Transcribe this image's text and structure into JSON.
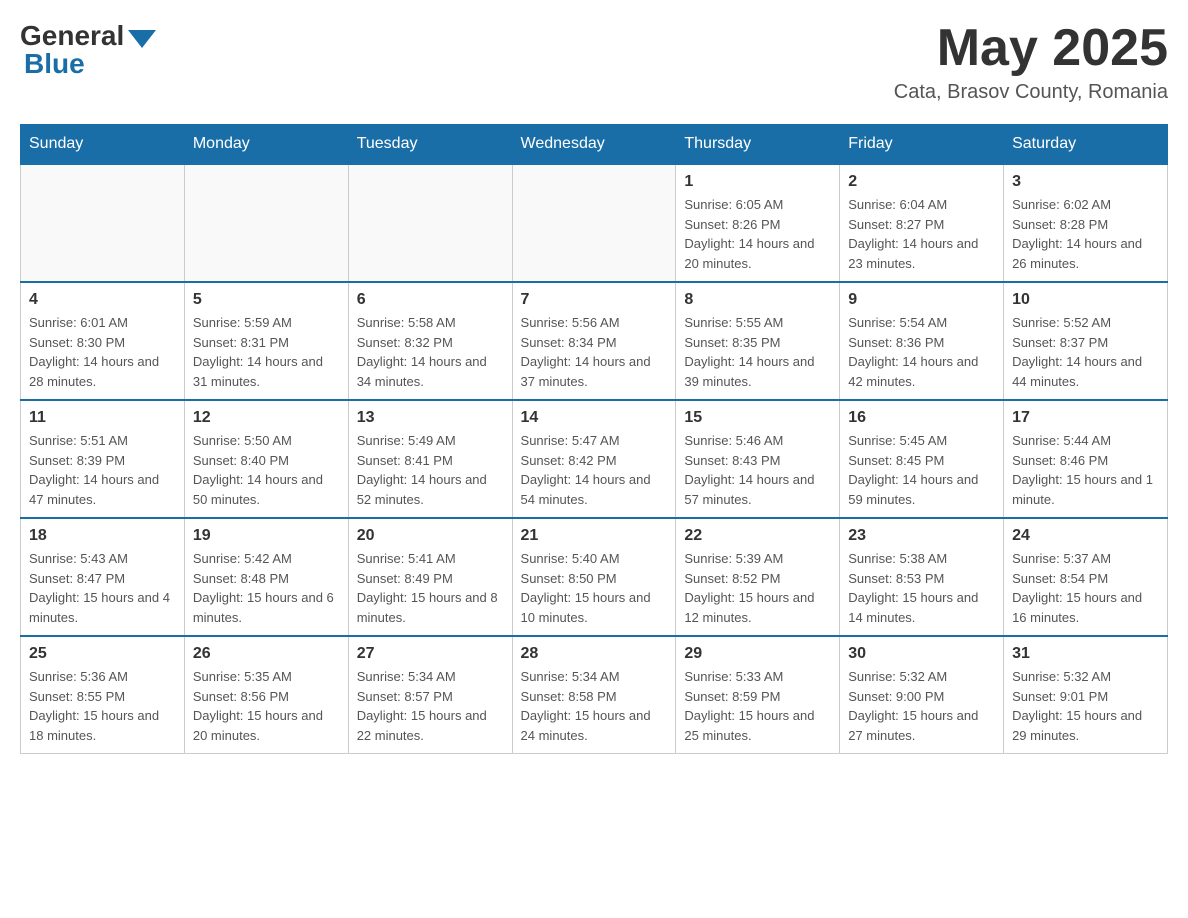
{
  "header": {
    "logo": {
      "general": "General",
      "blue": "Blue"
    },
    "title": "May 2025",
    "location": "Cata, Brasov County, Romania"
  },
  "days_of_week": [
    "Sunday",
    "Monday",
    "Tuesday",
    "Wednesday",
    "Thursday",
    "Friday",
    "Saturday"
  ],
  "weeks": [
    [
      {
        "day": "",
        "info": ""
      },
      {
        "day": "",
        "info": ""
      },
      {
        "day": "",
        "info": ""
      },
      {
        "day": "",
        "info": ""
      },
      {
        "day": "1",
        "info": "Sunrise: 6:05 AM\nSunset: 8:26 PM\nDaylight: 14 hours and 20 minutes."
      },
      {
        "day": "2",
        "info": "Sunrise: 6:04 AM\nSunset: 8:27 PM\nDaylight: 14 hours and 23 minutes."
      },
      {
        "day": "3",
        "info": "Sunrise: 6:02 AM\nSunset: 8:28 PM\nDaylight: 14 hours and 26 minutes."
      }
    ],
    [
      {
        "day": "4",
        "info": "Sunrise: 6:01 AM\nSunset: 8:30 PM\nDaylight: 14 hours and 28 minutes."
      },
      {
        "day": "5",
        "info": "Sunrise: 5:59 AM\nSunset: 8:31 PM\nDaylight: 14 hours and 31 minutes."
      },
      {
        "day": "6",
        "info": "Sunrise: 5:58 AM\nSunset: 8:32 PM\nDaylight: 14 hours and 34 minutes."
      },
      {
        "day": "7",
        "info": "Sunrise: 5:56 AM\nSunset: 8:34 PM\nDaylight: 14 hours and 37 minutes."
      },
      {
        "day": "8",
        "info": "Sunrise: 5:55 AM\nSunset: 8:35 PM\nDaylight: 14 hours and 39 minutes."
      },
      {
        "day": "9",
        "info": "Sunrise: 5:54 AM\nSunset: 8:36 PM\nDaylight: 14 hours and 42 minutes."
      },
      {
        "day": "10",
        "info": "Sunrise: 5:52 AM\nSunset: 8:37 PM\nDaylight: 14 hours and 44 minutes."
      }
    ],
    [
      {
        "day": "11",
        "info": "Sunrise: 5:51 AM\nSunset: 8:39 PM\nDaylight: 14 hours and 47 minutes."
      },
      {
        "day": "12",
        "info": "Sunrise: 5:50 AM\nSunset: 8:40 PM\nDaylight: 14 hours and 50 minutes."
      },
      {
        "day": "13",
        "info": "Sunrise: 5:49 AM\nSunset: 8:41 PM\nDaylight: 14 hours and 52 minutes."
      },
      {
        "day": "14",
        "info": "Sunrise: 5:47 AM\nSunset: 8:42 PM\nDaylight: 14 hours and 54 minutes."
      },
      {
        "day": "15",
        "info": "Sunrise: 5:46 AM\nSunset: 8:43 PM\nDaylight: 14 hours and 57 minutes."
      },
      {
        "day": "16",
        "info": "Sunrise: 5:45 AM\nSunset: 8:45 PM\nDaylight: 14 hours and 59 minutes."
      },
      {
        "day": "17",
        "info": "Sunrise: 5:44 AM\nSunset: 8:46 PM\nDaylight: 15 hours and 1 minute."
      }
    ],
    [
      {
        "day": "18",
        "info": "Sunrise: 5:43 AM\nSunset: 8:47 PM\nDaylight: 15 hours and 4 minutes."
      },
      {
        "day": "19",
        "info": "Sunrise: 5:42 AM\nSunset: 8:48 PM\nDaylight: 15 hours and 6 minutes."
      },
      {
        "day": "20",
        "info": "Sunrise: 5:41 AM\nSunset: 8:49 PM\nDaylight: 15 hours and 8 minutes."
      },
      {
        "day": "21",
        "info": "Sunrise: 5:40 AM\nSunset: 8:50 PM\nDaylight: 15 hours and 10 minutes."
      },
      {
        "day": "22",
        "info": "Sunrise: 5:39 AM\nSunset: 8:52 PM\nDaylight: 15 hours and 12 minutes."
      },
      {
        "day": "23",
        "info": "Sunrise: 5:38 AM\nSunset: 8:53 PM\nDaylight: 15 hours and 14 minutes."
      },
      {
        "day": "24",
        "info": "Sunrise: 5:37 AM\nSunset: 8:54 PM\nDaylight: 15 hours and 16 minutes."
      }
    ],
    [
      {
        "day": "25",
        "info": "Sunrise: 5:36 AM\nSunset: 8:55 PM\nDaylight: 15 hours and 18 minutes."
      },
      {
        "day": "26",
        "info": "Sunrise: 5:35 AM\nSunset: 8:56 PM\nDaylight: 15 hours and 20 minutes."
      },
      {
        "day": "27",
        "info": "Sunrise: 5:34 AM\nSunset: 8:57 PM\nDaylight: 15 hours and 22 minutes."
      },
      {
        "day": "28",
        "info": "Sunrise: 5:34 AM\nSunset: 8:58 PM\nDaylight: 15 hours and 24 minutes."
      },
      {
        "day": "29",
        "info": "Sunrise: 5:33 AM\nSunset: 8:59 PM\nDaylight: 15 hours and 25 minutes."
      },
      {
        "day": "30",
        "info": "Sunrise: 5:32 AM\nSunset: 9:00 PM\nDaylight: 15 hours and 27 minutes."
      },
      {
        "day": "31",
        "info": "Sunrise: 5:32 AM\nSunset: 9:01 PM\nDaylight: 15 hours and 29 minutes."
      }
    ]
  ]
}
